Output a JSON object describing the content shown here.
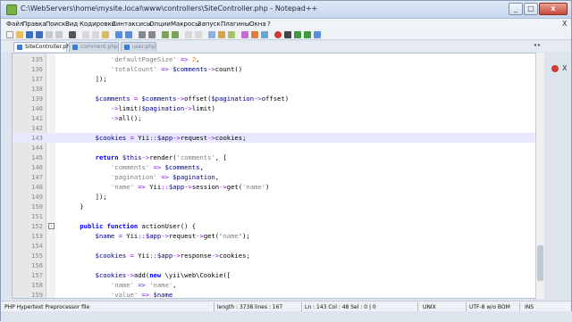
{
  "window": {
    "title": "C:\\WebServers\\home\\mysite.local\\www\\controllers\\SiteController.php - Notepad++",
    "min_label": "_",
    "max_label": "□",
    "close_label": "x"
  },
  "menu": {
    "items": [
      "Файл",
      "Правка",
      "Поиск",
      "Вид",
      "Кодировки",
      "Синтаксисы",
      "Опции",
      "Макросы",
      "Запуск",
      "Плагины",
      "Окна",
      "?"
    ],
    "close_label": "X"
  },
  "tabs": [
    {
      "label": "SiteController.php",
      "active": true
    },
    {
      "label": "comment.php",
      "active": false
    },
    {
      "label": "user.php",
      "active": false
    }
  ],
  "tab_controls": {
    "nav": "◂ ▸",
    "close": "X"
  },
  "editor": {
    "lines": [
      {
        "n": "135",
        "fold": "",
        "tokens": [
          [
            "str",
            "            'defaultPageSize' "
          ],
          [
            "op",
            "=>"
          ],
          [
            "plain",
            " "
          ],
          [
            "num",
            "2"
          ],
          [
            "plain",
            ","
          ]
        ]
      },
      {
        "n": "136",
        "fold": "",
        "tokens": [
          [
            "str",
            "            'totalCount' "
          ],
          [
            "op",
            "=>"
          ],
          [
            "plain",
            " "
          ],
          [
            "var",
            "$comments"
          ],
          [
            "op",
            "->"
          ],
          [
            "fn",
            "count"
          ],
          [
            "plain",
            "()"
          ]
        ]
      },
      {
        "n": "137",
        "fold": "",
        "tokens": [
          [
            "plain",
            "        ]);"
          ]
        ]
      },
      {
        "n": "138",
        "fold": "",
        "tokens": [
          [
            "plain",
            ""
          ]
        ]
      },
      {
        "n": "139",
        "fold": "",
        "tokens": [
          [
            "var",
            "        $comments "
          ],
          [
            "op",
            "="
          ],
          [
            "plain",
            " "
          ],
          [
            "var",
            "$comments"
          ],
          [
            "op",
            "->"
          ],
          [
            "fn",
            "offset"
          ],
          [
            "plain",
            "("
          ],
          [
            "var",
            "$pagination"
          ],
          [
            "op",
            "->"
          ],
          [
            "fn",
            "offset"
          ],
          [
            "plain",
            ")"
          ]
        ]
      },
      {
        "n": "140",
        "fold": "",
        "tokens": [
          [
            "plain",
            "            "
          ],
          [
            "op",
            "->"
          ],
          [
            "fn",
            "limit"
          ],
          [
            "plain",
            "("
          ],
          [
            "var",
            "$pagination"
          ],
          [
            "op",
            "->"
          ],
          [
            "fn",
            "limit"
          ],
          [
            "plain",
            ")"
          ]
        ]
      },
      {
        "n": "141",
        "fold": "",
        "tokens": [
          [
            "plain",
            "            "
          ],
          [
            "op",
            "->"
          ],
          [
            "fn",
            "all"
          ],
          [
            "plain",
            "();"
          ]
        ]
      },
      {
        "n": "142",
        "fold": "",
        "tokens": [
          [
            "plain",
            ""
          ]
        ]
      },
      {
        "n": "143",
        "fold": "",
        "current": true,
        "tokens": [
          [
            "var",
            "        $cookies "
          ],
          [
            "op",
            "="
          ],
          [
            "plain",
            " Yii"
          ],
          [
            "op",
            "::"
          ],
          [
            "var",
            "$app"
          ],
          [
            "op",
            "->"
          ],
          [
            "fn",
            "request"
          ],
          [
            "op",
            "->"
          ],
          [
            "fn",
            "cookies"
          ],
          [
            "plain",
            ";"
          ]
        ]
      },
      {
        "n": "144",
        "fold": "",
        "tokens": [
          [
            "plain",
            ""
          ]
        ]
      },
      {
        "n": "145",
        "fold": "",
        "tokens": [
          [
            "kw",
            "        return "
          ],
          [
            "var",
            "$this"
          ],
          [
            "op",
            "->"
          ],
          [
            "fn",
            "render"
          ],
          [
            "plain",
            "("
          ],
          [
            "str",
            "'comments'"
          ],
          [
            "plain",
            ", ["
          ]
        ]
      },
      {
        "n": "146",
        "fold": "",
        "tokens": [
          [
            "str",
            "            'comments' "
          ],
          [
            "op",
            "=>"
          ],
          [
            "plain",
            " "
          ],
          [
            "var",
            "$comments"
          ],
          [
            "plain",
            ","
          ]
        ]
      },
      {
        "n": "147",
        "fold": "",
        "tokens": [
          [
            "str",
            "            'pagination' "
          ],
          [
            "op",
            "=>"
          ],
          [
            "plain",
            " "
          ],
          [
            "var",
            "$pagination"
          ],
          [
            "plain",
            ","
          ]
        ]
      },
      {
        "n": "148",
        "fold": "",
        "tokens": [
          [
            "str",
            "            'name' "
          ],
          [
            "op",
            "=>"
          ],
          [
            "plain",
            " Yii"
          ],
          [
            "op",
            "::"
          ],
          [
            "var",
            "$app"
          ],
          [
            "op",
            "->"
          ],
          [
            "fn",
            "session"
          ],
          [
            "op",
            "->"
          ],
          [
            "fn",
            "get"
          ],
          [
            "plain",
            "("
          ],
          [
            "str",
            "'name'"
          ],
          [
            "plain",
            ")"
          ]
        ]
      },
      {
        "n": "149",
        "fold": "",
        "tokens": [
          [
            "plain",
            "        ]);"
          ]
        ]
      },
      {
        "n": "150",
        "fold": "",
        "tokens": [
          [
            "plain",
            "    }"
          ]
        ]
      },
      {
        "n": "151",
        "fold": "",
        "tokens": [
          [
            "plain",
            ""
          ]
        ]
      },
      {
        "n": "152",
        "fold": "-",
        "tokens": [
          [
            "kw",
            "    public function "
          ],
          [
            "fn",
            "actionUser"
          ],
          [
            "plain",
            "() {"
          ]
        ]
      },
      {
        "n": "153",
        "fold": "",
        "tokens": [
          [
            "var",
            "        $name "
          ],
          [
            "op",
            "="
          ],
          [
            "plain",
            " Yii"
          ],
          [
            "op",
            "::"
          ],
          [
            "var",
            "$app"
          ],
          [
            "op",
            "->"
          ],
          [
            "fn",
            "request"
          ],
          [
            "op",
            "->"
          ],
          [
            "fn",
            "get"
          ],
          [
            "plain",
            "("
          ],
          [
            "str",
            "\"name\""
          ],
          [
            "plain",
            ");"
          ]
        ]
      },
      {
        "n": "154",
        "fold": "",
        "tokens": [
          [
            "plain",
            ""
          ]
        ]
      },
      {
        "n": "155",
        "fold": "",
        "tokens": [
          [
            "var",
            "        $cookies "
          ],
          [
            "op",
            "="
          ],
          [
            "plain",
            " Yii"
          ],
          [
            "op",
            "::"
          ],
          [
            "var",
            "$app"
          ],
          [
            "op",
            "->"
          ],
          [
            "fn",
            "response"
          ],
          [
            "op",
            "->"
          ],
          [
            "fn",
            "cookies"
          ],
          [
            "plain",
            ";"
          ]
        ]
      },
      {
        "n": "156",
        "fold": "",
        "tokens": [
          [
            "plain",
            ""
          ]
        ]
      },
      {
        "n": "157",
        "fold": "",
        "tokens": [
          [
            "var",
            "        $cookies"
          ],
          [
            "op",
            "->"
          ],
          [
            "fn",
            "add"
          ],
          [
            "plain",
            "("
          ],
          [
            "kw",
            "new "
          ],
          [
            "plain",
            "\\yii\\web\\Cookie(["
          ]
        ]
      },
      {
        "n": "158",
        "fold": "",
        "tokens": [
          [
            "str",
            "            'name' "
          ],
          [
            "op",
            "=>"
          ],
          [
            "plain",
            " "
          ],
          [
            "str",
            "'name'"
          ],
          [
            "plain",
            ","
          ]
        ]
      },
      {
        "n": "159",
        "fold": "",
        "tokens": [
          [
            "str",
            "            'value' "
          ],
          [
            "op",
            "=>"
          ],
          [
            "plain",
            " "
          ],
          [
            "var",
            "$name"
          ]
        ]
      }
    ]
  },
  "status": {
    "filetype": "PHP Hypertext Preprocessor file",
    "length": "length : 3738",
    "lines": "lines : 167",
    "position": "Ln : 143   Col : 48   Sel : 0 | 0",
    "eol": "UNIX",
    "encoding": "UTF-8 w/o BOM",
    "mode": "INS"
  },
  "colors": {
    "current_line": "#e8e8ff",
    "keyword": "#0000ff",
    "variable": "#000080",
    "string": "#808080",
    "operator": "#8000ff",
    "number": "#ff8000"
  }
}
